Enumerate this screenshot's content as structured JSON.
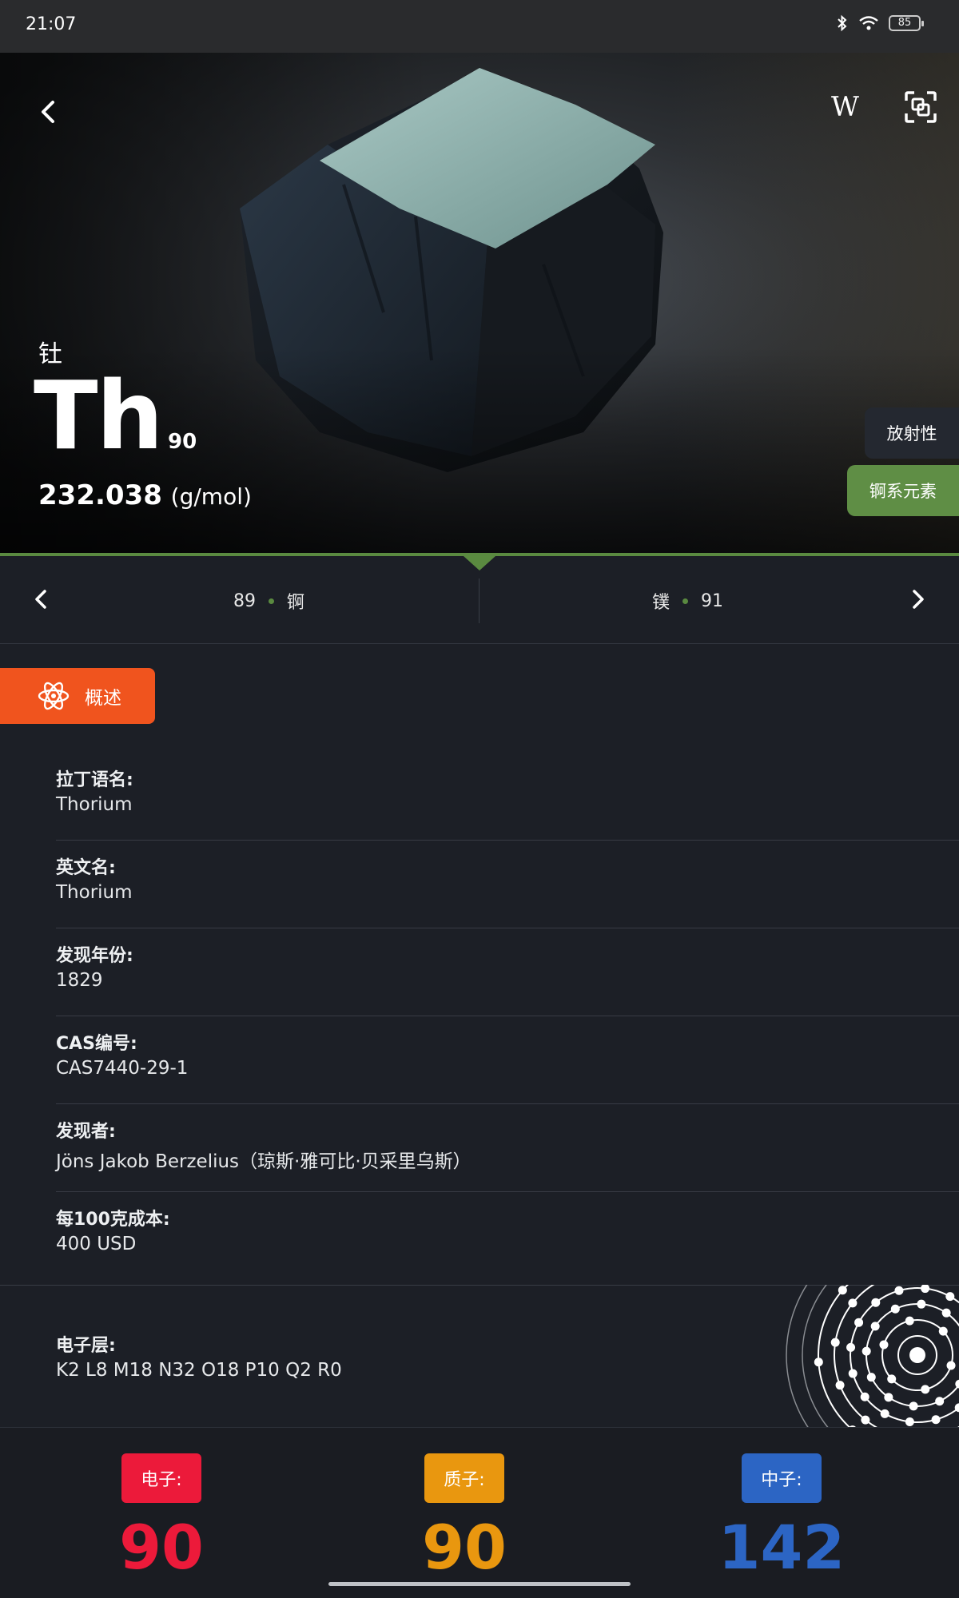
{
  "status_bar": {
    "time": "21:07",
    "battery": "85"
  },
  "hero": {
    "wiki_label": "W",
    "name_cn": "钍",
    "symbol": "Th",
    "atomic_number": "90",
    "mass_value": "232.038",
    "mass_unit": "(g/mol)",
    "tags": [
      "放射性",
      "锕系元素"
    ],
    "colors": {
      "tag_series": "#5f8e45",
      "accent_line": "#5a8a40"
    }
  },
  "nav": {
    "prev_number": "89",
    "prev_name": "锕",
    "next_name": "镤",
    "next_number": "91"
  },
  "overview_tab": {
    "label": "概述",
    "icon": "atom-icon",
    "color": "#f0541e"
  },
  "info": [
    {
      "label": "拉丁语名:",
      "value": "Thorium"
    },
    {
      "label": "英文名:",
      "value": "Thorium"
    },
    {
      "label": "发现年份:",
      "value": "1829"
    },
    {
      "label": "CAS编号:",
      "value": "CAS7440-29-1"
    },
    {
      "label": "发现者:",
      "value": "Jöns Jakob Berzelius（琼斯·雅可比·贝采里乌斯）"
    },
    {
      "label": "每100克成本:",
      "value": "400 USD"
    }
  ],
  "shell": {
    "label": "电子层:",
    "value": "K2 L8 M18 N32 O18 P10 Q2 R0"
  },
  "particles": {
    "electron": {
      "label": "电子:",
      "value": "90",
      "color": "#ec1a3a"
    },
    "proton": {
      "label": "质子:",
      "value": "90",
      "color": "#e9970f"
    },
    "neutron": {
      "label": "中子:",
      "value": "142",
      "color": "#2c65c4"
    }
  }
}
